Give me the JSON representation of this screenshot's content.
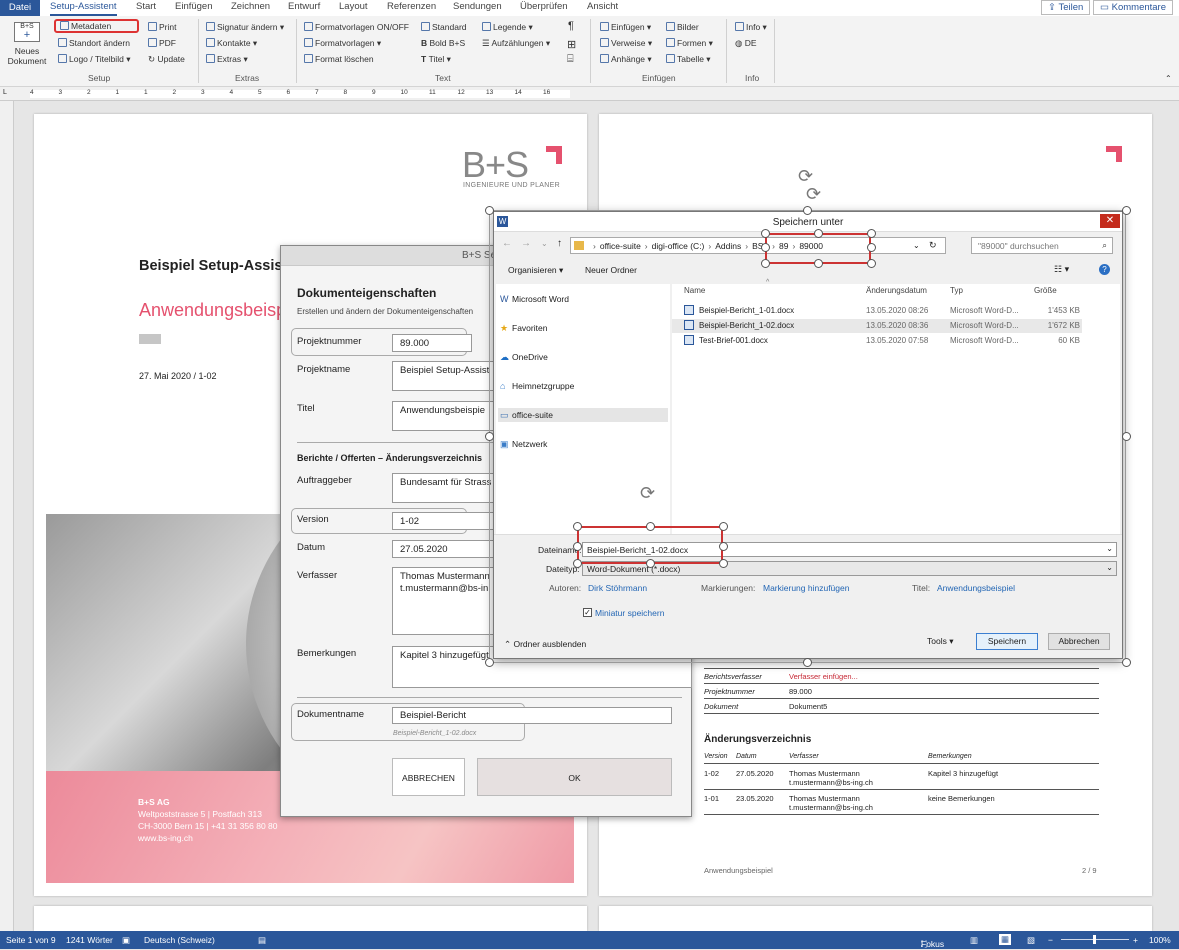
{
  "tabs": {
    "file": "Datei",
    "setup": "Setup-Assistent",
    "start": "Start",
    "insert": "Einfügen",
    "draw": "Zeichnen",
    "design": "Entwurf",
    "layout": "Layout",
    "references": "Referenzen",
    "mailings": "Sendungen",
    "review": "Überprüfen",
    "view": "Ansicht",
    "share": "Teilen",
    "comments": "Kommentare"
  },
  "ribbon": {
    "new_doc": "Neues Dokument",
    "metadata": "Metadaten",
    "location": "Standort ändern",
    "logo": "Logo / Titelbild",
    "print": "Print",
    "pdf": "PDF",
    "update": "Update",
    "group_setup": "Setup",
    "signature": "Signatur ändern",
    "contacts": "Kontakte",
    "extras": "Extras",
    "group_extras": "Extras",
    "styles_toggle": "Formatvorlagen ON/OFF",
    "styles": "Formatvorlagen",
    "clear_format": "Format löschen",
    "standard": "Standard",
    "bold": "Bold B+S",
    "title": "Titel",
    "legend": "Legende",
    "lists": "Aufzählungen",
    "group_text": "Text",
    "insert": "Einfügen",
    "references": "Verweise",
    "attachments": "Anhänge",
    "images": "Bilder",
    "shapes": "Formen",
    "table": "Tabelle",
    "group_insert": "Einfügen",
    "info": "Info",
    "de": "DE",
    "group_info": "Info"
  },
  "ruler": [
    "4",
    "3",
    "2",
    "1",
    "1",
    "2",
    "3",
    "4",
    "5",
    "6",
    "7",
    "8",
    "9",
    "10",
    "11",
    "12",
    "13",
    "14",
    "16"
  ],
  "page1": {
    "logo": "B+S",
    "logo_sub": "INGENIEURE UND PLANER",
    "title": "Beispiel Setup-Assis",
    "subtitle": "Anwendungsbeisp",
    "date": "27. Mai 2020 / 1-02",
    "company": "B+S AG",
    "address1": "Weltpoststrasse 5 | Postfach 313",
    "address2": "CH-3000 Bern 15 | +41 31 356 80 80",
    "web": "www.bs-ing.ch"
  },
  "page2": {
    "meta_rows": [
      {
        "k": "Berichtsverfasser",
        "v": "Verfasser einfügen..."
      },
      {
        "k": "Projektnummer",
        "v": "89.000"
      },
      {
        "k": "Dokument",
        "v": "Dokument5"
      }
    ],
    "changelog_title": "Änderungsverzeichnis",
    "changelog_headers": [
      "Version",
      "Datum",
      "Verfasser",
      "Bemerkungen"
    ],
    "changelog": [
      {
        "version": "1-02",
        "date": "27.05.2020",
        "author": "Thomas Mustermann",
        "email": "t.mustermann@bs-ing.ch",
        "note": "Kapitel 3 hinzugefügt"
      },
      {
        "version": "1-01",
        "date": "23.05.2020",
        "author": "Thomas Mustermann",
        "email": "t.mustermann@bs-ing.ch",
        "note": "keine Bemerkungen"
      }
    ],
    "footer": "Anwendungsbeispiel",
    "page": "2 / 9"
  },
  "setup": {
    "title": "B+S Setup",
    "heading": "Dokumenteigenschaften",
    "desc": "Erstellen und ändern der Dokumenteigenschaften",
    "projnr_label": "Projektnummer",
    "projnr": "89.000",
    "projname_label": "Projektname",
    "projname": "Beispiel Setup-Assist",
    "title_label": "Titel",
    "title_val": "Anwendungsbeispie",
    "section2": "Berichte / Offerten  –  Änderungsverzeichnis",
    "client_label": "Auftraggeber",
    "client": "Bundesamt für Strass",
    "version_label": "Version",
    "version": "1-02",
    "date_label": "Datum",
    "date": "27.05.2020",
    "author_label": "Verfasser",
    "author": "Thomas Mustermann",
    "author_mail": "t.mustermann@bs-in",
    "remarks_label": "Bemerkungen",
    "remarks": "Kapitel 3 hinzugefügt",
    "docname_label": "Dokumentname",
    "docname": "Beispiel-Bericht",
    "docname_hint": "Beispiel-Bericht_1-02.docx",
    "cancel": "ABBRECHEN",
    "ok": "OK"
  },
  "save": {
    "title": "Speichern unter",
    "path": [
      "office-suite",
      "digi-office (C:)",
      "Addins",
      "BS1",
      "89",
      "89000"
    ],
    "search": "\"89000\" durchsuchen",
    "organize": "Organisieren",
    "new_folder": "Neuer Ordner",
    "nav": [
      "Microsoft Word",
      "Favoriten",
      "OneDrive",
      "Heimnetzgruppe",
      "office-suite",
      "Netzwerk"
    ],
    "headers": [
      "Name",
      "Änderungsdatum",
      "Typ",
      "Größe"
    ],
    "files": [
      {
        "name": "Beispiel-Bericht_1-01.docx",
        "date": "13.05.2020 08:26",
        "type": "Microsoft Word-D...",
        "size": "1'453 KB"
      },
      {
        "name": "Beispiel-Bericht_1-02.docx",
        "date": "13.05.2020 08:36",
        "type": "Microsoft Word-D...",
        "size": "1'672 KB"
      },
      {
        "name": "Test-Brief-001.docx",
        "date": "13.05.2020 07:58",
        "type": "Microsoft Word-D...",
        "size": "60 KB"
      }
    ],
    "filename_label": "Dateiname:",
    "filename": "Beispiel-Bericht_1-02.docx",
    "filetype_label": "Dateityp:",
    "filetype": "Word-Dokument (*.docx)",
    "authors_label": "Autoren:",
    "authors": "Dirk Stöhrmann",
    "tags_label": "Markierungen:",
    "tags": "Markierung hinzufügen",
    "title_label": "Titel:",
    "title_val": "Anwendungsbeispiel",
    "thumb": "Miniatur speichern",
    "hide": "Ordner ausblenden",
    "tools": "Tools",
    "save": "Speichern",
    "cancel": "Abbrechen"
  },
  "status": {
    "page": "Seite 1 von 9",
    "words": "1241 Wörter",
    "lang": "Deutsch (Schweiz)",
    "focus": "Fokus",
    "zoom": "100%"
  }
}
